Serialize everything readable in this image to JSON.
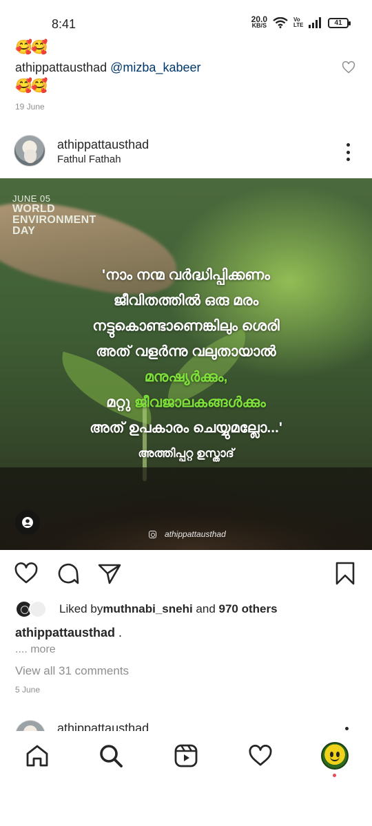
{
  "status_bar": {
    "time": "8:41",
    "net_speed_value": "20.0",
    "net_speed_unit": "KB/S",
    "volte": "Vo LTE",
    "battery": "41"
  },
  "previous_comment": {
    "top_emoji": "🥰🥰",
    "username": "athippattausthad",
    "mention": "@mizba_kabeer",
    "text_emoji": "🥰🥰",
    "date": "19 June"
  },
  "post": {
    "username": "athippattausthad",
    "subtitle": "Fathul Fathah",
    "image": {
      "date": "JUNE 05",
      "title_line1": "WORLD",
      "title_line2": "ENVIRONMENT",
      "title_line3": "DAY",
      "quote_line1": "'നാം നന്മ വർദ്ധിപ്പിക്കണം",
      "quote_line2": "ജീവിതത്തിൽ ഒരു മരം",
      "quote_line3": "നട്ടുകൊണ്ടാണെങ്കിലും ശെരി",
      "quote_line4": "അത് വളർന്നു വലുതായാൽ",
      "quote_line5": "മനുഷ്യർക്കും,",
      "quote_line6a": "മറ്റു ",
      "quote_line6b": "ജീവജാലകങ്ങൾക്കും",
      "quote_line7": "അത് ഉപകാരം ചെയ്യുമല്ലോ...'",
      "author": "അത്തിപ്പറ്റ ഉസ്താദ്",
      "ig_handle": "athippattausthad"
    },
    "likes": {
      "prefix": "Liked by ",
      "user": "muthnabi_snehi",
      "and": " and ",
      "others": "970 others"
    },
    "caption_user": "athippattausthad",
    "caption_text": " .",
    "more": ".... more",
    "view_comments": "View all 31 comments",
    "date": "5 June"
  },
  "next_post": {
    "username": "athippattausthad"
  },
  "colors": {
    "text": "#262626",
    "secondary": "#8e8e8e",
    "mention": "#00376b",
    "highlight_green": "#7ee03a",
    "notification": "#ed4956"
  },
  "icons": [
    "heart-icon",
    "comment-icon",
    "share-icon",
    "bookmark-icon",
    "home-icon",
    "search-icon",
    "reels-icon",
    "activity-icon",
    "more-icon",
    "user-tag-icon",
    "instagram-icon"
  ]
}
